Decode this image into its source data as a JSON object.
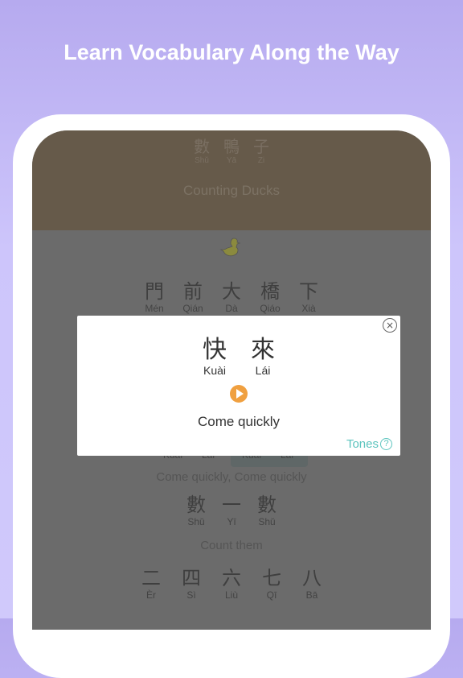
{
  "headline": "Learn Vocabulary Along the Way",
  "header": {
    "title_chars": [
      {
        "hz": "數",
        "py": "Shǔ"
      },
      {
        "hz": "鴨",
        "py": "Yā"
      },
      {
        "hz": "子",
        "py": "Zi"
      }
    ],
    "title": "Counting Ducks"
  },
  "lines": [
    {
      "chars": [
        {
          "hz": "門",
          "py": "Mén"
        },
        {
          "hz": "前",
          "py": "Qián"
        },
        {
          "hz": "大",
          "py": "Dà"
        },
        {
          "hz": "橋",
          "py": "Qiáo"
        },
        {
          "hz": "下",
          "py": "Xià"
        }
      ]
    },
    {
      "chars": [
        {
          "hz": "",
          "py": "Kuài"
        },
        {
          "hz": "",
          "py": "Lái"
        },
        {
          "hz": "",
          "py": "Kuài"
        },
        {
          "hz": "",
          "py": "Lái"
        }
      ],
      "translation": "Come quickly, Come quickly"
    },
    {
      "chars": [
        {
          "hz": "數",
          "py": "Shǔ"
        },
        {
          "hz": "一",
          "py": "Yī"
        },
        {
          "hz": "數",
          "py": "Shǔ"
        }
      ],
      "translation": "Count them"
    },
    {
      "chars": [
        {
          "hz": "二",
          "py": "Èr"
        },
        {
          "hz": "四",
          "py": "Sì"
        },
        {
          "hz": "六",
          "py": "Liù"
        },
        {
          "hz": "七",
          "py": "Qī"
        },
        {
          "hz": "八",
          "py": "Bā"
        }
      ]
    }
  ],
  "modal": {
    "chars": [
      {
        "hz": "快",
        "py": "Kuài"
      },
      {
        "hz": "來",
        "py": "Lái"
      }
    ],
    "translation": "Come quickly",
    "tones_label": "Tones",
    "close_icon": "×",
    "help_icon": "?"
  },
  "colors": {
    "accent": "#5cc4be",
    "play": "#f0a040",
    "header": "#665a4a"
  }
}
